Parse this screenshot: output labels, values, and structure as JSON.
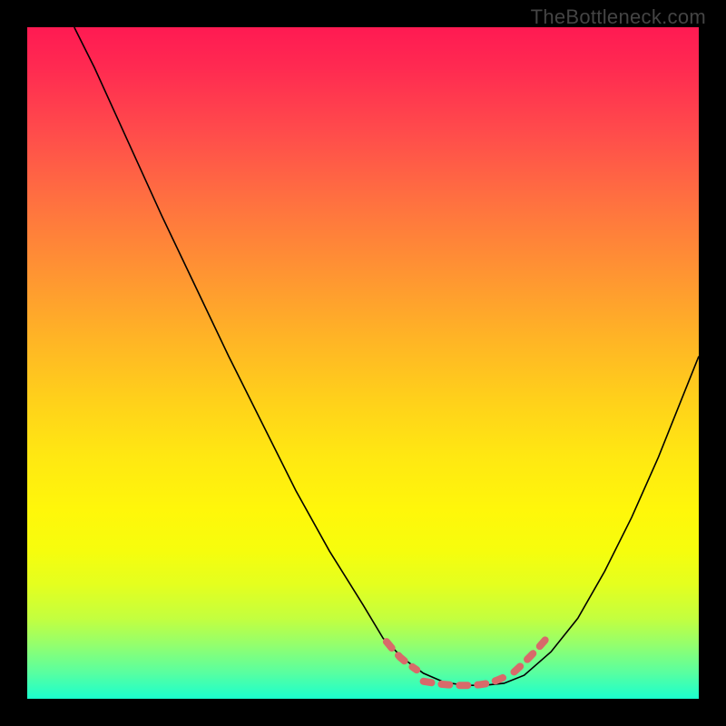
{
  "watermark": "TheBottleneck.com",
  "chart_data": {
    "type": "line",
    "title": "",
    "xlabel": "",
    "ylabel": "",
    "xlim": [
      0,
      100
    ],
    "ylim": [
      0,
      100
    ],
    "grid": false,
    "legend": false,
    "series": [
      {
        "name": "curve",
        "x": [
          7,
          10,
          15,
          20,
          25,
          30,
          35,
          40,
          45,
          50,
          53,
          56,
          59,
          62,
          65,
          68,
          71,
          74,
          78,
          82,
          86,
          90,
          94,
          98,
          100
        ],
        "values": [
          100,
          94,
          83,
          72,
          61.5,
          51,
          41,
          31,
          22,
          14,
          9,
          6,
          3.8,
          2.5,
          2,
          2,
          2.3,
          3.5,
          7,
          12,
          19,
          27,
          36,
          46,
          51
        ],
        "color": "#000000"
      },
      {
        "name": "highlight-left-dash",
        "x": [
          53.5,
          54.5,
          55.5,
          56.7,
          58.0
        ],
        "values": [
          8.5,
          7.3,
          6.2,
          5.2,
          4.3
        ],
        "color": "#d86a6a",
        "style": "dashed-thick"
      },
      {
        "name": "highlight-flat-dash",
        "x": [
          59.0,
          60.2,
          61.4,
          62.6,
          63.8,
          65.0,
          66.2,
          67.4,
          68.6,
          69.8,
          71.0
        ],
        "values": [
          2.6,
          2.4,
          2.2,
          2.1,
          2.0,
          2.0,
          2.0,
          2.1,
          2.3,
          2.7,
          3.2
        ],
        "color": "#d86a6a",
        "style": "dashed-thick"
      },
      {
        "name": "highlight-right-dash",
        "x": [
          72.5,
          73.7,
          75.0,
          76.3,
          77.6
        ],
        "values": [
          4.0,
          5.1,
          6.4,
          7.8,
          9.3
        ],
        "color": "#d86a6a",
        "style": "dashed-thick"
      }
    ],
    "background_gradient": {
      "stops": [
        {
          "pos": 0.0,
          "color": "#ff1a52"
        },
        {
          "pos": 0.16,
          "color": "#ff4d4b"
        },
        {
          "pos": 0.36,
          "color": "#ff9233"
        },
        {
          "pos": 0.56,
          "color": "#ffd21a"
        },
        {
          "pos": 0.72,
          "color": "#fff70a"
        },
        {
          "pos": 0.88,
          "color": "#c4ff3e"
        },
        {
          "pos": 1.0,
          "color": "#1affce"
        }
      ]
    }
  }
}
